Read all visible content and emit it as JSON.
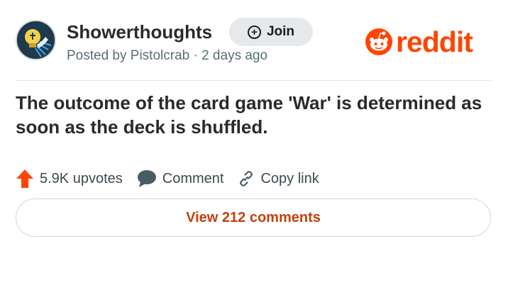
{
  "post": {
    "subreddit": "Showerthoughts",
    "join_label": "Join",
    "meta": "Posted by Pistolcrab · 2 days ago",
    "title": "The outcome of the card game 'War' is determined as soon as the deck is shuffled."
  },
  "brand": {
    "wordmark": "reddit",
    "color": "#ff4500"
  },
  "actions": {
    "upvotes": "5.9K upvotes",
    "comment": "Comment",
    "copy_link": "Copy link"
  },
  "footer": {
    "view_comments": "View 212 comments"
  },
  "icons": {
    "avatar": "lightbulb-shower-icon",
    "join": "plus-circle-icon",
    "upvote": "upvote-arrow-icon",
    "comment": "speech-bubble-icon",
    "copy_link": "link-icon",
    "logo": "reddit-alien-icon"
  },
  "colors": {
    "accent": "#ff4500",
    "link_text": "#c2410c",
    "meta_text": "#576f76"
  }
}
